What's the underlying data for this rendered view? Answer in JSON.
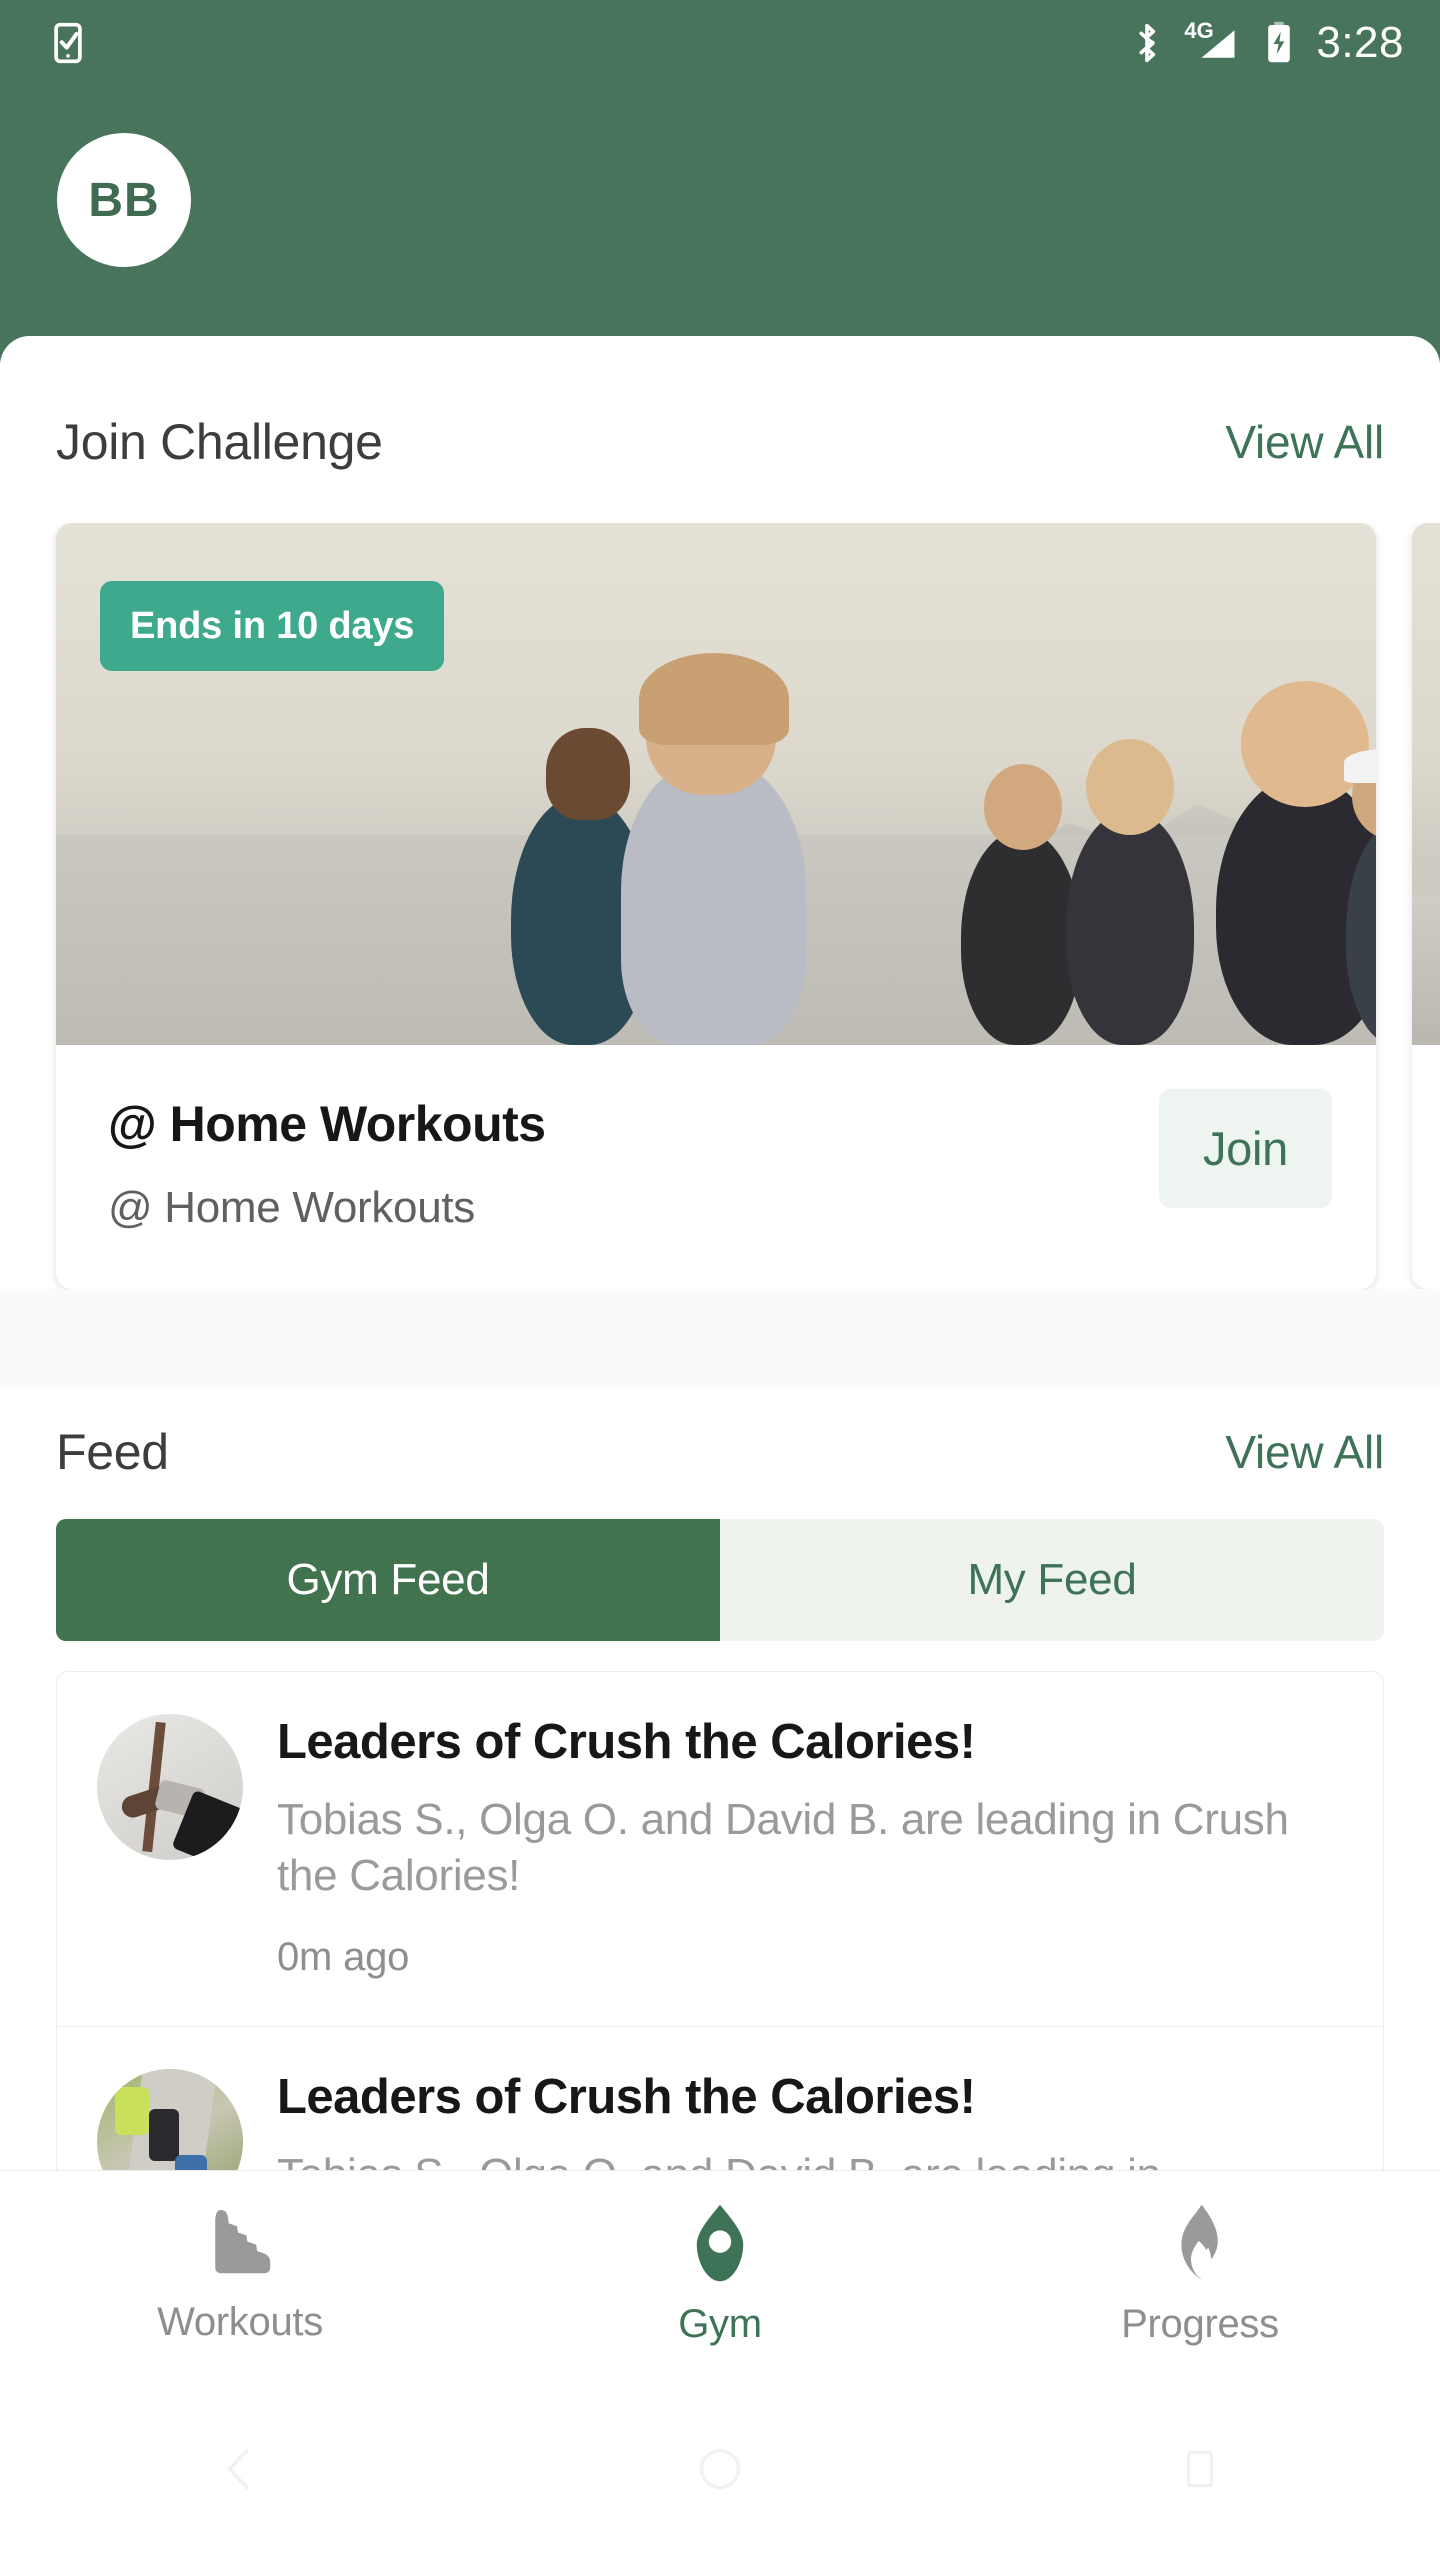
{
  "status_bar": {
    "notification_icon": "phone-check-icon",
    "bluetooth_icon": "bluetooth-icon",
    "network_label": "4G",
    "signal_icon": "signal-bars-icon",
    "battery_icon": "battery-charging-icon",
    "time": "3:28"
  },
  "header": {
    "avatar_initials": "BB",
    "background_color": "#47745a"
  },
  "challenge_section": {
    "title": "Join Challenge",
    "view_all_label": "View All",
    "cards": [
      {
        "badge": "Ends in 10 days",
        "title": "@ Home Workouts",
        "subtitle": "@ Home Workouts",
        "action_label": "Join",
        "image_alt": "group-of-runners-on-beach-photo"
      }
    ]
  },
  "feed_section": {
    "title": "Feed",
    "view_all_label": "View All",
    "tabs": [
      {
        "label": "Gym Feed",
        "active": true
      },
      {
        "label": "My Feed",
        "active": false
      }
    ],
    "items": [
      {
        "title": "Leaders of Crush the Calories!",
        "description": "Tobias S., Olga O. and David B. are leading in Crush the Calories!",
        "time": "0m ago",
        "avatar_alt": "yoga-pose-photo"
      },
      {
        "title": "Leaders of Crush the Calories!",
        "description": "Tobias S., Olga O. and David B. are leading in",
        "time": "",
        "avatar_alt": "runners-on-path-photo"
      }
    ]
  },
  "bottom_nav": {
    "items": [
      {
        "label": "Workouts",
        "icon": "shoe-icon",
        "active": false
      },
      {
        "label": "Gym",
        "icon": "location-pin-icon",
        "active": true
      },
      {
        "label": "Progress",
        "icon": "flame-icon",
        "active": false
      }
    ]
  },
  "system_nav": {
    "back_icon": "back-chevron-icon",
    "home_icon": "home-circle-icon",
    "recents_icon": "recents-square-icon"
  },
  "colors": {
    "brand_green": "#47745a",
    "accent_green": "#3e7358",
    "badge_teal": "#3fa98e",
    "tab_active": "#42734f",
    "tab_inactive_bg": "#eef3ee",
    "join_btn_bg": "#eef4ef"
  }
}
